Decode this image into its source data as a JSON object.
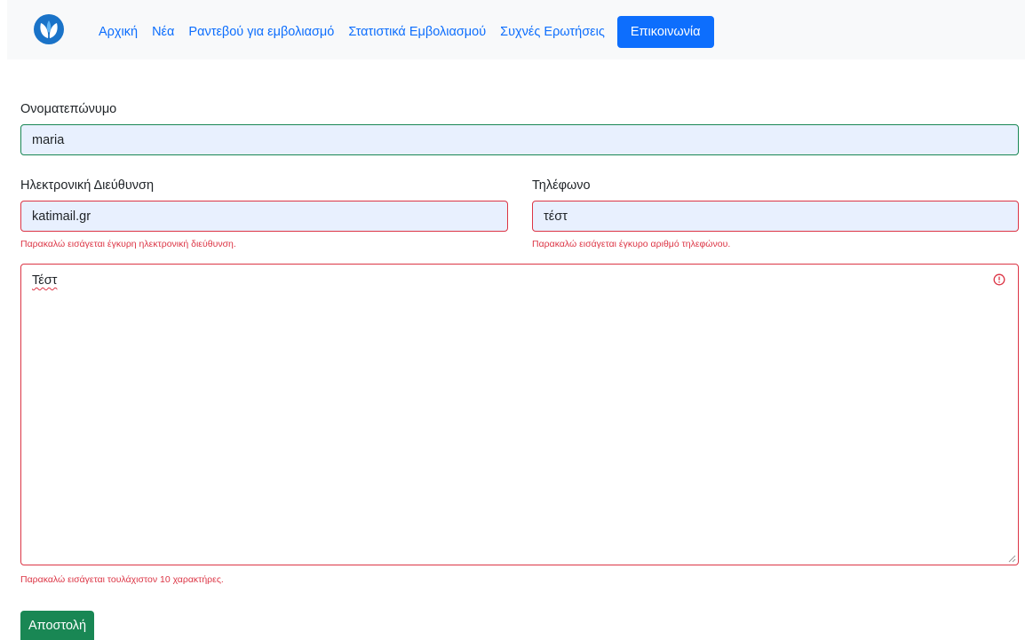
{
  "nav": {
    "logo_icon": "leaf-logo-icon",
    "links": [
      {
        "label": "Αρχική"
      },
      {
        "label": "Νέα"
      },
      {
        "label": "Ραντεβού για εμβολιασμό"
      },
      {
        "label": "Στατιστικά Εμβολιασμού"
      },
      {
        "label": "Συχνές Ερωτήσεις"
      },
      {
        "label": "Επικοινωνία",
        "active": true
      }
    ]
  },
  "form": {
    "name": {
      "label": "Ονοματεπώνυμο",
      "value": "maria"
    },
    "email": {
      "label": "Ηλεκτρονική Διεύθυνση",
      "value": "katimail.gr",
      "error": "Παρακαλώ εισάγεται έγκυρη ηλεκτρονική διεύθυνση."
    },
    "phone": {
      "label": "Τηλέφωνο",
      "value": "τέστ",
      "error": "Παρακαλώ εισάγεται έγκυρο αριθμό τηλεφώνου."
    },
    "message": {
      "value": "Τέστ",
      "error": "Παρακαλώ εισάγεται τουλάχιστον 10 χαρακτήρες."
    },
    "submit_label": "Αποστολή"
  },
  "colors": {
    "primary": "#0d6efd",
    "success": "#198754",
    "danger": "#dc3545",
    "autofill_bg": "#e8f0fe",
    "navbar_bg": "#f8f9fa"
  }
}
